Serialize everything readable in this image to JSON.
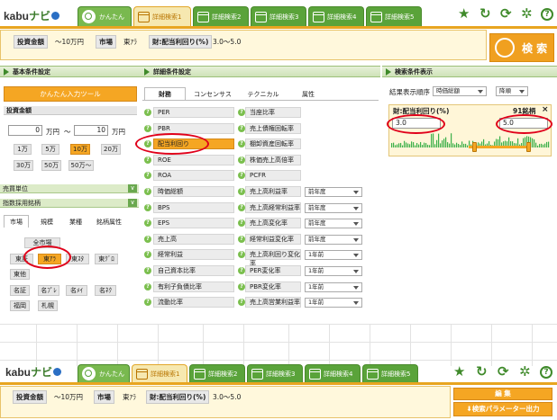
{
  "app": {
    "logo_kabu": "kabu",
    "logo_navi": "ナビ"
  },
  "tabs": [
    {
      "label": "かんたん"
    },
    {
      "label": "詳細検索1"
    },
    {
      "label": "詳細検索2"
    },
    {
      "label": "詳細検索3"
    },
    {
      "label": "詳細検索4"
    },
    {
      "label": "詳細検索5"
    }
  ],
  "toolbar_icons": [
    "star-icon",
    "reload-icon",
    "refresh-icon",
    "gear-icon",
    "help-icon"
  ],
  "summary": {
    "amount_label": "投資金額",
    "amount_value": "〜10万円",
    "market_label": "市場",
    "market_value": "東ｱﾗ",
    "yield_label": "財:配当利回り(%)",
    "yield_value": "3.0〜5.0"
  },
  "search_button": "検 索",
  "bottom_buttons": {
    "edit": "編 集",
    "export": "検索パラメーター出力"
  },
  "basic": {
    "header": "基本条件設定",
    "tool_button": "かんたん入力ツール",
    "amount_section": "投資金額",
    "amount_min": "0",
    "amount_max": "10",
    "unit": "万円",
    "tilde": "〜",
    "amount_chips": [
      "1万",
      "5万",
      "10万",
      "20万",
      "30万",
      "50万",
      "50万〜"
    ],
    "trade_unit": "売買単位",
    "index_members": "指数採用銘柄",
    "market_tabs": [
      "市場",
      "規模",
      "業種",
      "銘柄属性"
    ],
    "all_markets": "全市場",
    "markets": [
      "東証",
      "東ｱﾗ",
      "東ｽﾀ",
      "東ｸﾞﾛ",
      "東他",
      "名証",
      "名ﾌﾟﾚ",
      "名ﾒｲ",
      "名ﾈｸ",
      "福岡",
      "札幌"
    ]
  },
  "detail": {
    "header": "詳細条件設定",
    "tabs": [
      "財務",
      "コンセンサス",
      "テクニカル",
      "属性"
    ],
    "left_items": [
      "PER",
      "PBR",
      "配当利回り",
      "ROE",
      "ROA",
      "時価総額",
      "BPS",
      "EPS",
      "売上高",
      "経常利益",
      "自己資本比率",
      "有利子負債比率",
      "流動比率"
    ],
    "right_items": [
      "当座比率",
      "売上債権回転率",
      "棚卸資産回転率",
      "株価売上高倍率",
      "PCFR",
      "売上高利益率",
      "売上高経常利益率",
      "売上高変化率",
      "経常利益変化率",
      "売上高利回り変化率",
      "PER変化率",
      "PBR変化率",
      "売上高営業利益率"
    ],
    "selects": [
      "前年度",
      "前年度",
      "前年度",
      "前年度",
      "1年前",
      "1年前",
      "1年前",
      "1年前"
    ]
  },
  "result": {
    "header": "検索条件表示",
    "order_label": "結果表示順序",
    "order_value": "時価総額",
    "direction_value": "降順",
    "filter_title": "財:配当利回り(%)",
    "count": "91銘柄",
    "close": "×",
    "min": "3.0",
    "max": "5.0"
  },
  "colors": {
    "accent": "#f5a623",
    "brand": "#3f8a2a",
    "ring": "#e0001a"
  }
}
